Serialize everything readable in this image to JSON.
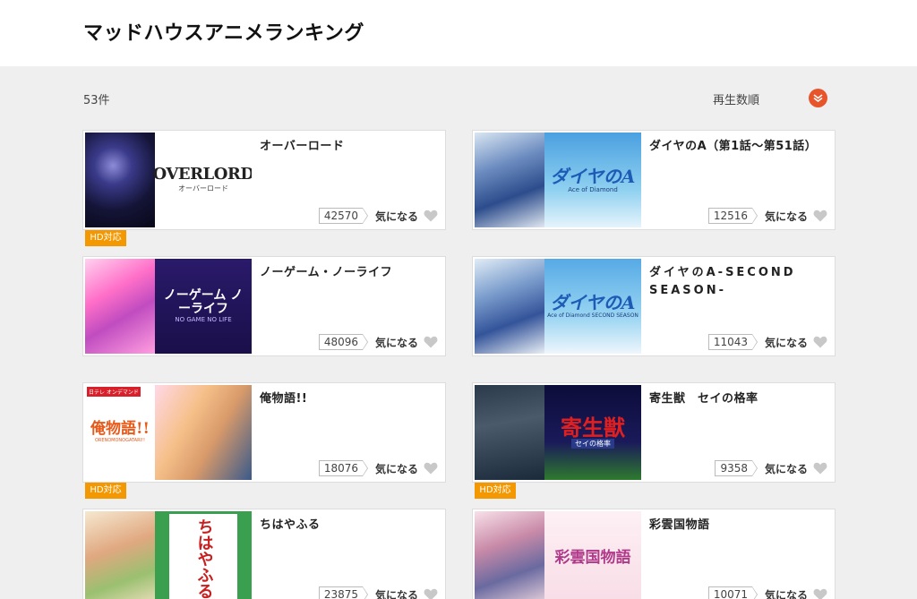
{
  "header": {
    "title": "マッドハウスアニメランキング"
  },
  "toolbar": {
    "count": "53件",
    "sort_label": "再生数順"
  },
  "items": [
    {
      "title": "オーバーロード",
      "count": "42570",
      "fav_label": "気になる",
      "hd": "HD対応",
      "logo": "OVERLORD",
      "logo_sub": "オーバーロード"
    },
    {
      "title": "ダイヤのA（第1話〜第51話）",
      "count": "12516",
      "fav_label": "気になる",
      "logo": "ダイヤのA",
      "logo_sub": "Ace of Diamond"
    },
    {
      "title": "ノーゲーム・ノーライフ",
      "count": "48096",
      "fav_label": "気になる",
      "logo": "ノーゲーム ノーライフ",
      "logo_sub": "NO GAME NO LIFE"
    },
    {
      "title": "ダイヤのA-SECOND SEASON-",
      "count": "11043",
      "fav_label": "気になる",
      "logo": "ダイヤのA",
      "logo_sub": "Ace of Diamond SECOND SEASON"
    },
    {
      "title": "俺物語!!",
      "count": "18076",
      "fav_label": "気になる",
      "hd": "HD対応",
      "logo": "俺物語!!",
      "logo_sub": "ORENOMONOGATARI!!",
      "brand": "日テレ オンデマンド"
    },
    {
      "title": "寄生獣　セイの格率",
      "count": "9358",
      "fav_label": "気になる",
      "hd": "HD対応",
      "logo": "寄生獣",
      "logo_sub": "セイの格率"
    },
    {
      "title": "ちはやふる",
      "count": "23875",
      "fav_label": "気になる",
      "logo": "ちはやふる"
    },
    {
      "title": "彩雲国物語",
      "count": "10071",
      "fav_label": "気になる",
      "logo": "彩雲国物語"
    }
  ],
  "colors": {
    "accent": "#e8552b",
    "hd": "#f39800",
    "bg": "#efefef"
  }
}
